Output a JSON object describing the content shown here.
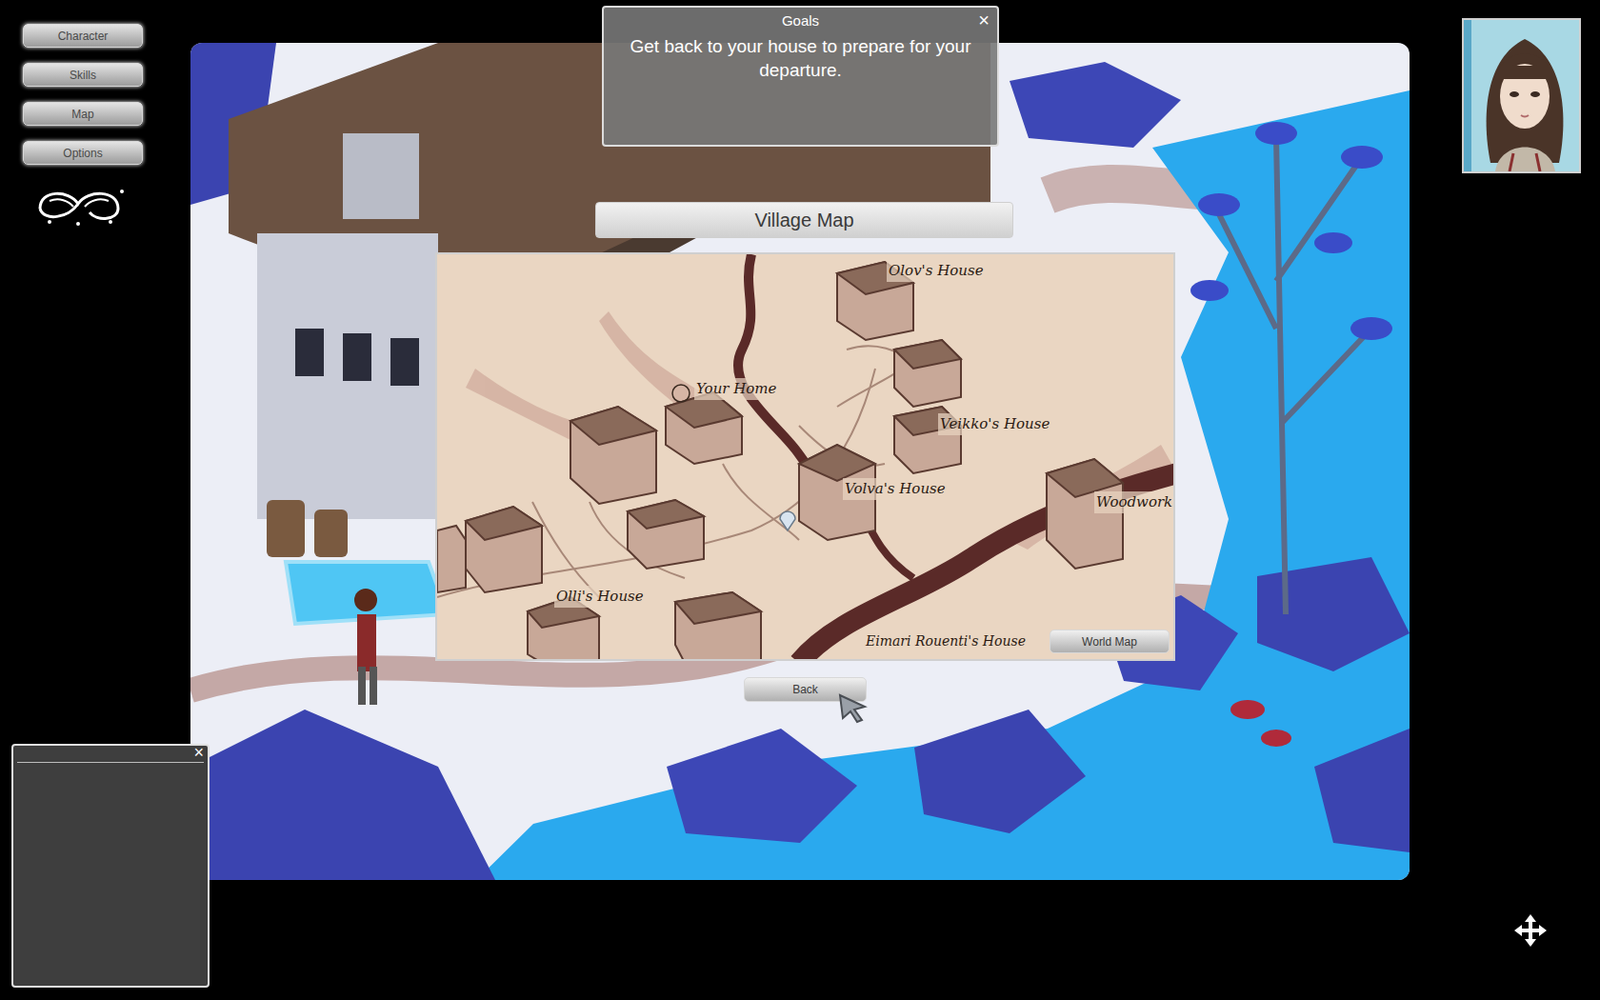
{
  "menu": [
    {
      "label": "Character"
    },
    {
      "label": "Skills"
    },
    {
      "label": "Map"
    },
    {
      "label": "Options"
    }
  ],
  "goals": {
    "title": "Goals",
    "close": "×",
    "text": "Get back to your house to prepare for your departure."
  },
  "village_map": {
    "title": "Village Map",
    "locations": [
      {
        "label": "Olov's House"
      },
      {
        "label": "Your Home"
      },
      {
        "label": "Veikko's House"
      },
      {
        "label": "Volva's House"
      },
      {
        "label": "Woodwork"
      },
      {
        "label": "Olli's House"
      },
      {
        "label": "Eimari Rouenti's House"
      }
    ],
    "world_map_button": "World Map",
    "back_button": "Back"
  },
  "chat": {
    "close": "×"
  }
}
